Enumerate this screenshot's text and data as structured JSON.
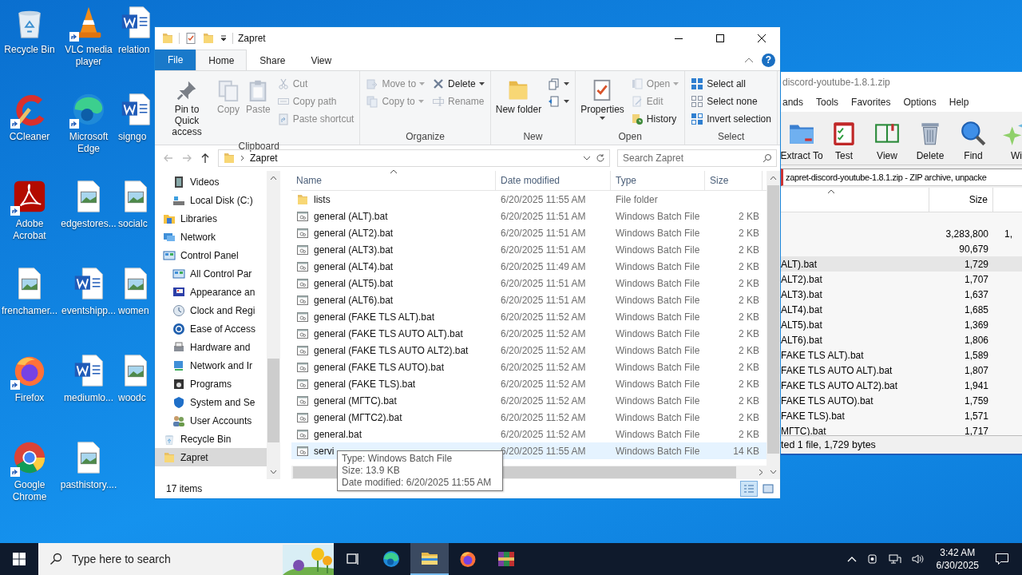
{
  "desktop": {
    "icons": [
      {
        "label": "Recycle Bin",
        "kind": "recycle",
        "shortcut": false
      },
      {
        "label": "CCleaner",
        "kind": "ccleaner",
        "shortcut": true
      },
      {
        "label": "Adobe Acrobat",
        "kind": "acrobat",
        "shortcut": true
      },
      {
        "label": "frenchamer...",
        "kind": "image",
        "shortcut": false
      },
      {
        "label": "Firefox",
        "kind": "firefox",
        "shortcut": true
      },
      {
        "label": "Google Chrome",
        "kind": "chrome",
        "shortcut": true
      },
      {
        "label": "VLC media player",
        "kind": "vlc",
        "shortcut": true
      },
      {
        "label": "Microsoft Edge",
        "kind": "edge",
        "shortcut": true
      },
      {
        "label": "edgestores...",
        "kind": "image",
        "shortcut": false
      },
      {
        "label": "eventshipp...",
        "kind": "word",
        "shortcut": false
      },
      {
        "label": "mediumlo...",
        "kind": "word",
        "shortcut": false
      },
      {
        "label": "pasthistory....",
        "kind": "image",
        "shortcut": false
      },
      {
        "label": "relation",
        "kind": "word",
        "shortcut": false
      },
      {
        "label": "signgo",
        "kind": "word",
        "shortcut": false
      },
      {
        "label": "socialc",
        "kind": "image",
        "shortcut": false
      },
      {
        "label": "women",
        "kind": "image",
        "shortcut": false
      },
      {
        "label": "woodc",
        "kind": "image",
        "shortcut": false
      }
    ]
  },
  "explorer": {
    "title": "Zapret",
    "tabs": [
      {
        "label": "File",
        "kind": "file",
        "selected": false
      },
      {
        "label": "Home",
        "kind": "tab",
        "selected": true
      },
      {
        "label": "Share",
        "kind": "tab",
        "selected": false
      },
      {
        "label": "View",
        "kind": "tab",
        "selected": false
      }
    ],
    "help": "?",
    "ribbon": {
      "groups": [
        {
          "label": "Clipboard",
          "columns": [
            {
              "kind": "large",
              "items": [
                {
                  "label": "Pin to Quick access",
                  "kind": "pin",
                  "disabled": false,
                  "dropdown": false
                }
              ]
            },
            {
              "kind": "large",
              "items": [
                {
                  "label": "Copy",
                  "kind": "copy",
                  "disabled": true,
                  "dropdown": false
                }
              ]
            },
            {
              "kind": "large",
              "items": [
                {
                  "label": "Paste",
                  "kind": "paste",
                  "disabled": true,
                  "dropdown": false
                }
              ]
            },
            {
              "kind": "small",
              "items": [
                {
                  "label": "Cut",
                  "kind": "cut",
                  "disabled": true,
                  "dropdown": false
                },
                {
                  "label": "Copy path",
                  "kind": "copypath",
                  "disabled": true,
                  "dropdown": false
                },
                {
                  "label": "Paste shortcut",
                  "kind": "pasteshortcut",
                  "disabled": true,
                  "dropdown": false
                }
              ]
            }
          ]
        },
        {
          "label": "Organize",
          "columns": [
            {
              "kind": "small",
              "items": [
                {
                  "label": "Move to",
                  "kind": "move",
                  "disabled": true,
                  "dropdown": true
                },
                {
                  "label": "Copy to",
                  "kind": "copyto",
                  "disabled": true,
                  "dropdown": true
                }
              ]
            },
            {
              "kind": "small",
              "items": [
                {
                  "label": "Delete",
                  "kind": "delete",
                  "disabled": false,
                  "dropdown": true
                },
                {
                  "label": "Rename",
                  "kind": "rename",
                  "disabled": true,
                  "dropdown": false
                }
              ]
            }
          ]
        },
        {
          "label": "New",
          "columns": [
            {
              "kind": "large",
              "items": [
                {
                  "label": "New folder",
                  "kind": "newfolder",
                  "disabled": false,
                  "dropdown": false
                }
              ]
            },
            {
              "kind": "small",
              "items": [
                {
                  "kind": "newitem",
                  "disabled": false,
                  "dropdown": true
                },
                {
                  "kind": "easyaccess",
                  "disabled": false,
                  "dropdown": true
                }
              ]
            }
          ]
        },
        {
          "label": "Open",
          "columns": [
            {
              "kind": "large",
              "items": [
                {
                  "label": "Properties",
                  "kind": "properties",
                  "disabled": false,
                  "dropdown": true
                }
              ]
            },
            {
              "kind": "small",
              "items": [
                {
                  "label": "Open",
                  "kind": "open",
                  "disabled": true,
                  "dropdown": true
                },
                {
                  "label": "Edit",
                  "kind": "edit",
                  "disabled": true,
                  "dropdown": false
                },
                {
                  "label": "History",
                  "kind": "history",
                  "disabled": false,
                  "dropdown": false
                }
              ]
            }
          ]
        },
        {
          "label": "Select",
          "columns": [
            {
              "kind": "small",
              "items": [
                {
                  "label": "Select all",
                  "kind": "selectall",
                  "disabled": false,
                  "dropdown": false
                },
                {
                  "label": "Select none",
                  "kind": "selectnone",
                  "disabled": false,
                  "dropdown": false
                },
                {
                  "label": "Invert selection",
                  "kind": "invert",
                  "disabled": false,
                  "dropdown": false
                }
              ]
            }
          ]
        }
      ]
    },
    "address": "Zapret",
    "search_placeholder": "Search Zapret",
    "nav": [
      {
        "children": [
          {
            "label": "Videos",
            "kind": "videos",
            "selected": false
          },
          {
            "label": "Local Disk (C:)",
            "kind": "disk",
            "selected": false
          }
        ]
      },
      {
        "label": "Libraries",
        "kind": "libraries",
        "selected": false
      },
      {
        "label": "Network",
        "kind": "network",
        "selected": false
      },
      {
        "label": "Control Panel",
        "kind": "cpanel",
        "selected": false,
        "children": [
          {
            "label": "All Control Par",
            "kind": "cpanel",
            "selected": false
          },
          {
            "label": "Appearance an",
            "kind": "appearance",
            "selected": false
          },
          {
            "label": "Clock and Regi",
            "kind": "clock",
            "selected": false
          },
          {
            "label": "Ease of Access",
            "kind": "ease",
            "selected": false
          },
          {
            "label": "Hardware and",
            "kind": "hardware",
            "selected": false
          },
          {
            "label": "Network and Ir",
            "kind": "netinternet",
            "selected": false
          },
          {
            "label": "Programs",
            "kind": "programs",
            "selected": false
          },
          {
            "label": "System and Se",
            "kind": "security",
            "selected": false
          },
          {
            "label": "User Accounts",
            "kind": "users",
            "selected": false
          }
        ]
      },
      {
        "label": "Recycle Bin",
        "kind": "recycle",
        "selected": false
      },
      {
        "label": "Zapret",
        "kind": "folder",
        "selected": true
      }
    ],
    "columns": [
      {
        "label": "Name",
        "sorted": true
      },
      {
        "label": "Date modified",
        "sorted": false
      },
      {
        "label": "Type",
        "sorted": false
      },
      {
        "label": "Size",
        "sorted": false
      }
    ],
    "rows": [
      {
        "name": "lists",
        "kind": "folder",
        "date": "6/20/2025 11:55 AM",
        "type": "File folder",
        "selected": false
      },
      {
        "name": "general (ALT).bat",
        "kind": "batch",
        "date": "6/20/2025 11:51 AM",
        "type": "Windows Batch File",
        "size": "2 KB",
        "selected": false
      },
      {
        "name": "general (ALT2).bat",
        "kind": "batch",
        "date": "6/20/2025 11:51 AM",
        "type": "Windows Batch File",
        "size": "2 KB",
        "selected": false
      },
      {
        "name": "general (ALT3).bat",
        "kind": "batch",
        "date": "6/20/2025 11:51 AM",
        "type": "Windows Batch File",
        "size": "2 KB",
        "selected": false
      },
      {
        "name": "general (ALT4).bat",
        "kind": "batch",
        "date": "6/20/2025 11:49 AM",
        "type": "Windows Batch File",
        "size": "2 KB",
        "selected": false
      },
      {
        "name": "general (ALT5).bat",
        "kind": "batch",
        "date": "6/20/2025 11:51 AM",
        "type": "Windows Batch File",
        "size": "2 KB",
        "selected": false
      },
      {
        "name": "general (ALT6).bat",
        "kind": "batch",
        "date": "6/20/2025 11:51 AM",
        "type": "Windows Batch File",
        "size": "2 KB",
        "selected": false
      },
      {
        "name": "general (FAKE TLS ALT).bat",
        "kind": "batch",
        "date": "6/20/2025 11:52 AM",
        "type": "Windows Batch File",
        "size": "2 KB",
        "selected": false
      },
      {
        "name": "general (FAKE TLS AUTO ALT).bat",
        "kind": "batch",
        "date": "6/20/2025 11:52 AM",
        "type": "Windows Batch File",
        "size": "2 KB",
        "selected": false
      },
      {
        "name": "general (FAKE TLS AUTO ALT2).bat",
        "kind": "batch",
        "date": "6/20/2025 11:52 AM",
        "type": "Windows Batch File",
        "size": "2 KB",
        "selected": false
      },
      {
        "name": "general (FAKE TLS AUTO).bat",
        "kind": "batch",
        "date": "6/20/2025 11:52 AM",
        "type": "Windows Batch File",
        "size": "2 KB",
        "selected": false
      },
      {
        "name": "general (FAKE TLS).bat",
        "kind": "batch",
        "date": "6/20/2025 11:52 AM",
        "type": "Windows Batch File",
        "size": "2 KB",
        "selected": false
      },
      {
        "name": "general (МГТС).bat",
        "kind": "batch",
        "date": "6/20/2025 11:52 AM",
        "type": "Windows Batch File",
        "size": "2 KB",
        "selected": false
      },
      {
        "name": "general (МГТС2).bat",
        "kind": "batch",
        "date": "6/20/2025 11:52 AM",
        "type": "Windows Batch File",
        "size": "2 KB",
        "selected": false
      },
      {
        "name": "general.bat",
        "kind": "batch",
        "date": "6/20/2025 11:52 AM",
        "type": "Windows Batch File",
        "size": "2 KB",
        "selected": false
      },
      {
        "name": "servi",
        "kind": "batch",
        "date": "6/20/2025 11:55 AM",
        "type": "Windows Batch File",
        "size": "14 KB",
        "selected": true
      }
    ],
    "tooltip": [
      "Type: Windows Batch File",
      "Size: 13.9 KB",
      "Date modified: 6/20/2025 11:55 AM"
    ],
    "status": "17 items",
    "view_modes": [
      {
        "kind": "details",
        "selected": true
      },
      {
        "kind": "tiles",
        "selected": false
      }
    ]
  },
  "archiver": {
    "title": "discord-youtube-1.8.1.zip",
    "menu": [
      "ands",
      "Tools",
      "Favorites",
      "Options",
      "Help"
    ],
    "toolbar": [
      {
        "label": "Extract To",
        "kind": "extract"
      },
      {
        "label": "Test",
        "kind": "test"
      },
      {
        "label": "View",
        "kind": "view"
      },
      {
        "label": "Delete",
        "kind": "delete"
      },
      {
        "label": "Find",
        "kind": "find"
      },
      {
        "label": "Wi",
        "kind": "wizard"
      }
    ],
    "path": "zapret-discord-youtube-1.8.1.zip - ZIP archive, unpacke",
    "size_header": "Size",
    "rows": [
      {
        "size": "3,283,800",
        "column_3": "1,",
        "selected": false
      },
      {
        "size": "90,679",
        "selected": false
      },
      {
        "name": "ALT).bat",
        "size": "1,729",
        "selected": true
      },
      {
        "name": "ALT2).bat",
        "size": "1,707",
        "selected": false
      },
      {
        "name": "ALT3).bat",
        "size": "1,637",
        "selected": false
      },
      {
        "name": "ALT4).bat",
        "size": "1,685",
        "selected": false
      },
      {
        "name": "ALT5).bat",
        "size": "1,369",
        "selected": false
      },
      {
        "name": "ALT6).bat",
        "size": "1,806",
        "selected": false
      },
      {
        "name": "FAKE TLS ALT).bat",
        "size": "1,589",
        "selected": false
      },
      {
        "name": "FAKE TLS AUTO ALT).bat",
        "size": "1,807",
        "selected": false
      },
      {
        "name": "FAKE TLS AUTO ALT2).bat",
        "size": "1,941",
        "selected": false
      },
      {
        "name": "FAKE TLS AUTO).bat",
        "size": "1,759",
        "selected": false
      },
      {
        "name": "FAKE TLS).bat",
        "size": "1,571",
        "selected": false
      },
      {
        "name": "МГТС).bat",
        "size": "1,717",
        "selected": false
      }
    ],
    "status": "ted 1 file, 1,729 bytes"
  },
  "taskbar": {
    "search_placeholder": "Type here to search",
    "apps": [
      {
        "kind": "taskview",
        "selected": false
      },
      {
        "kind": "edge",
        "selected": false
      },
      {
        "kind": "explorer",
        "selected": true
      },
      {
        "kind": "firefox",
        "selected": false
      },
      {
        "kind": "winrar",
        "selected": false
      }
    ],
    "time": "3:42 AM",
    "date": "6/30/2025"
  }
}
